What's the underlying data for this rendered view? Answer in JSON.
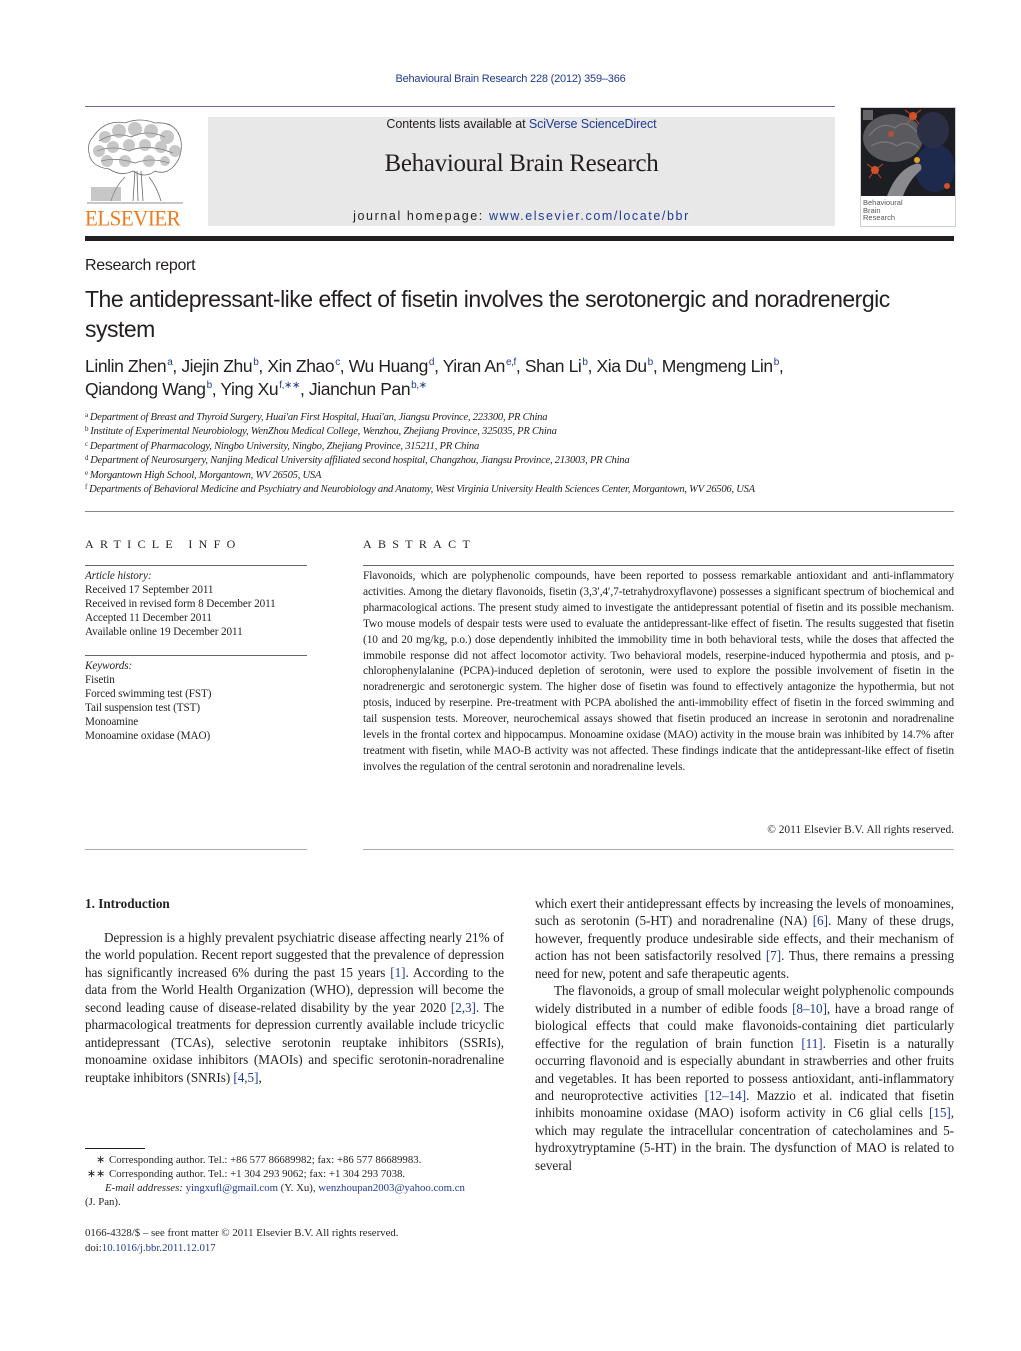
{
  "running_header": "Behavioural Brain Research 228 (2012) 359–366",
  "masthead": {
    "publisher_logo_text": "ELSEVIER",
    "contents_prefix": "Contents lists available at ",
    "contents_link": "SciVerse ScienceDirect",
    "journal_title": "Behavioural Brain Research",
    "homepage_prefix": "journal homepage: ",
    "homepage_url": "www.elsevier.com/locate/bbr",
    "cover_title_lines": [
      "Behavioural",
      "Brain",
      "Research"
    ],
    "colors": {
      "link": "#1f3a93",
      "elsevier_orange": "#f07b1d",
      "banner_bg": "#e8e8e8"
    }
  },
  "article": {
    "type": "Research report",
    "title": "The antidepressant-like effect of fisetin involves the serotonergic and noradrenergic system",
    "authors": [
      {
        "name": "Linlin Zhen",
        "aff": "a",
        "sep": ", "
      },
      {
        "name": "Jiejin Zhu",
        "aff": "b",
        "sep": ", "
      },
      {
        "name": "Xin Zhao",
        "aff": "c",
        "sep": ", "
      },
      {
        "name": "Wu Huang",
        "aff": "d",
        "sep": ", "
      },
      {
        "name": "Yiran An",
        "aff": "e,f",
        "sep": ", "
      },
      {
        "name": "Shan Li",
        "aff": "b",
        "sep": ", "
      },
      {
        "name": "Xia Du",
        "aff": "b",
        "sep": ", "
      },
      {
        "name": "Mengmeng Lin",
        "aff": "b",
        "sep": ", "
      },
      {
        "name": "Qiandong Wang",
        "aff": "b",
        "sep": ", "
      },
      {
        "name": "Ying Xu",
        "aff": "f,∗∗",
        "sep": ", "
      },
      {
        "name": "Jianchun Pan",
        "aff": "b,∗",
        "sep": ""
      }
    ],
    "affiliations": [
      {
        "key": "a",
        "text": "Department of Breast and Thyroid Surgery, Huai'an First Hospital, Huai'an, Jiangsu Province, 223300, PR China"
      },
      {
        "key": "b",
        "text": "Institute of Experimental Neurobiology, WenZhou Medical College, Wenzhou, Zhejiang Province, 325035, PR China"
      },
      {
        "key": "c",
        "text": "Department of Pharmacology, Ningbo University, Ningbo, Zhejiang Province, 315211, PR China"
      },
      {
        "key": "d",
        "text": "Department of Neurosurgery, Nanjing Medical University affiliated second hospital, Changzhou, Jiangsu Province, 213003, PR China"
      },
      {
        "key": "e",
        "text": "Morgantown High School, Morgantown, WV 26505, USA"
      },
      {
        "key": "f",
        "text": "Departments of Behavioral Medicine and Psychiatry and Neurobiology and Anatomy, West Virginia University Health Sciences Center, Morgantown, WV 26506, USA"
      }
    ]
  },
  "article_info": {
    "heading": "ARTICLE INFO",
    "history_label": "Article history:",
    "history": [
      "Received 17 September 2011",
      "Received in revised form 8 December 2011",
      "Accepted 11 December 2011",
      "Available online 19 December 2011"
    ],
    "keywords_label": "Keywords:",
    "keywords": [
      "Fisetin",
      "Forced swimming test (FST)",
      "Tail suspension test (TST)",
      "Monoamine",
      "Monoamine oxidase (MAO)"
    ]
  },
  "abstract": {
    "heading": "ABSTRACT",
    "text": "Flavonoids, which are polyphenolic compounds, have been reported to possess remarkable antioxidant and anti-inflammatory activities. Among the dietary flavonoids, fisetin (3,3′,4′,7-tetrahydroxyflavone) possesses a significant spectrum of biochemical and pharmacological actions. The present study aimed to investigate the antidepressant potential of fisetin and its possible mechanism. Two mouse models of despair tests were used to evaluate the antidepressant-like effect of fisetin. The results suggested that fisetin (10 and 20 mg/kg, p.o.) dose dependently inhibited the immobility time in both behavioral tests, while the doses that affected the immobile response did not affect locomotor activity. Two behavioral models, reserpine-induced hypothermia and ptosis, and p-chlorophenylalanine (PCPA)-induced depletion of serotonin, were used to explore the possible involvement of fisetin in the noradrenergic and serotonergic system. The higher dose of fisetin was found to effectively antagonize the hypothermia, but not ptosis, induced by reserpine. Pre-treatment with PCPA abolished the anti-immobility effect of fisetin in the forced swimming and tail suspension tests. Moreover, neurochemical assays showed that fisetin produced an increase in serotonin and noradrenaline levels in the frontal cortex and hippocampus. Monoamine oxidase (MAO) activity in the mouse brain was inhibited by 14.7% after treatment with fisetin, while MAO-B activity was not affected. These findings indicate that the antidepressant-like effect of fisetin involves the regulation of the central serotonin and noradrenaline levels.",
    "copyright": "© 2011 Elsevier B.V. All rights reserved."
  },
  "introduction": {
    "heading": "1.  Introduction",
    "paragraphs": [
      [
        {
          "t": "Depression is a highly prevalent psychiatric disease affecting nearly 21% of the world population. Recent report suggested that the prevalence of depression has significantly increased 6% during the past 15 years "
        },
        {
          "ref": "[1]"
        },
        {
          "t": ". According to the data from the World Health Organization (WHO), depression will become the second leading cause of disease-related disability by the year 2020 "
        },
        {
          "ref": "[2,3]"
        },
        {
          "t": ". The pharmacological treatments for depression currently available include tricyclic antidepressant (TCAs), selective serotonin reuptake inhibitors (SSRIs), monoamine oxidase inhibitors (MAOIs) and specific serotonin-noradrenaline reuptake inhibitors (SNRIs) "
        },
        {
          "ref": "[4,5]"
        },
        {
          "t": ", which exert their antidepressant effects by increasing the levels of monoamines, such as serotonin (5-HT) and noradrenaline (NA) "
        },
        {
          "ref": "[6]"
        },
        {
          "t": ". Many of these drugs, however, frequently produce undesirable side effects, and their mechanism of action has not been satisfactorily resolved "
        },
        {
          "ref": "[7]"
        },
        {
          "t": ". Thus, there remains a pressing need for new, potent and safe therapeutic agents."
        }
      ],
      [
        {
          "t": "The flavonoids, a group of small molecular weight polyphenolic compounds widely distributed in a number of edible foods "
        },
        {
          "ref": "[8–10]"
        },
        {
          "t": ", have a broad range of biological effects that could make flavonoids-containing diet particularly effective for the regulation of brain function "
        },
        {
          "ref": "[11]"
        },
        {
          "t": ". Fisetin is a naturally occurring flavonoid and is especially abundant in strawberries and other fruits and vegetables. It has been reported to possess antioxidant, anti-inflammatory and neuroprotective activities "
        },
        {
          "ref": "[12–14]"
        },
        {
          "t": ". Mazzio et al. indicated that fisetin inhibits monoamine oxidase (MAO) isoform activity in C6 glial cells "
        },
        {
          "ref": "[15]"
        },
        {
          "t": ", which may regulate the intracellular concentration of catecholamines and 5-hydroxytryptamine (5-HT) in the brain. The dysfunction of MAO is related to several"
        }
      ]
    ],
    "left_column": {
      "para1": [
        {
          "t": "Depression is a highly prevalent psychiatric disease affecting nearly 21% of the world population. Recent report suggested that the prevalence of depression has significantly increased 6% during the past 15 years "
        },
        {
          "ref": "[1]"
        },
        {
          "t": ". According to the data from the World Health Organization (WHO), depression will become the second leading cause of disease-related disability by the year 2020 "
        },
        {
          "ref": "[2,3]"
        },
        {
          "t": ". The pharmacological treatments for depression currently available include tricyclic antidepressant (TCAs), selective serotonin reuptake inhibitors (SSRIs), monoamine oxidase inhibitors (MAOIs) and specific serotonin-noradrenaline reuptake inhibitors (SNRIs) "
        },
        {
          "ref": "[4,5]"
        },
        {
          "t": ","
        }
      ]
    },
    "right_column": {
      "para1_cont": [
        {
          "t": "which exert their antidepressant effects by increasing the levels of monoamines, such as serotonin (5-HT) and noradrenaline (NA) "
        },
        {
          "ref": "[6]"
        },
        {
          "t": ". Many of these drugs, however, frequently produce undesirable side effects, and their mechanism of action has not been satisfactorily resolved "
        },
        {
          "ref": "[7]"
        },
        {
          "t": ". Thus, there remains a pressing need for new, potent and safe therapeutic agents."
        }
      ],
      "para2": [
        {
          "t": "The flavonoids, a group of small molecular weight polyphenolic compounds widely distributed in a number of edible foods "
        },
        {
          "ref": "[8–10]"
        },
        {
          "t": ", have a broad range of biological effects that could make flavonoids-containing diet particularly effective for the regulation of brain function "
        },
        {
          "ref": "[11]"
        },
        {
          "t": ". Fisetin is a naturally occurring flavonoid and is especially abundant in strawberries and other fruits and vegetables. It has been reported to possess antioxidant, anti-inflammatory and neuroprotective activities "
        },
        {
          "ref": "[12–14]"
        },
        {
          "t": ". Mazzio et al. indicated that fisetin inhibits monoamine oxidase (MAO) isoform activity in C6 glial cells "
        },
        {
          "ref": "[15]"
        },
        {
          "t": ", which may regulate the intracellular concentration of catecholamines and 5-hydroxytryptamine (5-HT) in the brain. The dysfunction of MAO is related to several"
        }
      ]
    }
  },
  "footnotes": {
    "corr1_mark": "∗",
    "corr1_text": "Corresponding author. Tel.: +86 577 86689982; fax: +86 577 86689983.",
    "corr2_mark": "∗∗",
    "corr2_text": "Corresponding author. Tel.: +1 304 293 9062; fax: +1 304 293 7038.",
    "email_label": "E-mail addresses:",
    "email1": "yingxufl@gmail.com",
    "email1_owner": " (Y. Xu), ",
    "email2": "wenzhoupan2003@yahoo.com.cn",
    "email2_owner": "(J. Pan)."
  },
  "front_matter": {
    "issn_line": "0166-4328/$ – see front matter © 2011 Elsevier B.V. All rights reserved.",
    "doi_prefix": "doi:",
    "doi": "10.1016/j.bbr.2011.12.017"
  }
}
